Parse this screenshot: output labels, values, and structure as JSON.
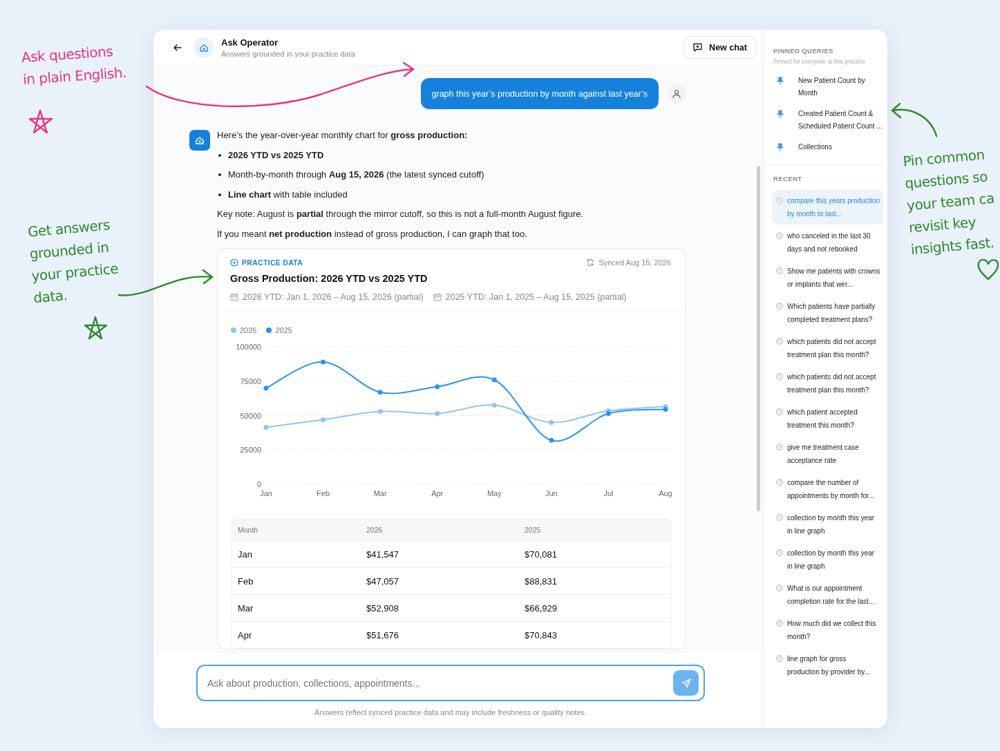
{
  "annotations": [
    {
      "color": "#e8337f",
      "lines": [
        "Ask questions",
        "in plain English."
      ]
    },
    {
      "color": "#2e8a2a",
      "lines": [
        "Get answers",
        "grounded in",
        "your practice",
        "data."
      ]
    },
    {
      "color": "#2e8a2a",
      "lines": [
        "Pin common",
        "questions so",
        "your team ca",
        "revisit key",
        "insights fast."
      ]
    }
  ],
  "header": {
    "title": "Ask Operator",
    "subtitle": "Answers grounded in your practice data",
    "new_chat": "New chat"
  },
  "user_message": "graph this year’s production by month against last year’s",
  "assistant": {
    "intro": "Here’s the year-over-year monthly chart for **gross production:**",
    "bullets": [
      "**2026 YTD vs 2025 YTD**",
      "Month-by-month through **Aug 15, 2026** (the latest synced cutoff)",
      "**Line chart** with table included"
    ],
    "notes": [
      "Key note: August is **partial** through the mirror cutoff, so this is not a full-month August figure.",
      "If you meant **net production** instead of gross production, I can graph that too."
    ]
  },
  "card": {
    "badge": "PRACTICE DATA",
    "synced": "Synced Aug 15, 2026",
    "title": "Gross Production: 2026 YTD vs 2025 YTD",
    "ranges": [
      "2026 YTD: Jan 1, 2026 – Aug 15, 2026 (partial)",
      "2025 YTD: Jan 1, 2025 – Aug 15, 2025 (partial)"
    ],
    "chart_data": {
      "type": "line",
      "categories": [
        "Jan",
        "Feb",
        "Mar",
        "Apr",
        "May",
        "Jun",
        "Jul",
        "Aug"
      ],
      "series": [
        {
          "name": "2026",
          "color": "#8ec5f3",
          "marker": true,
          "values": [
            41500,
            47000,
            53000,
            51500,
            57500,
            45000,
            53500,
            56500
          ]
        },
        {
          "name": "2025",
          "color": "#2b93ea",
          "marker": true,
          "values": [
            70000,
            89000,
            67000,
            71000,
            76000,
            32000,
            51500,
            54500
          ]
        }
      ],
      "grid": true,
      "ylim": [
        0,
        100000
      ],
      "yticks": [
        0,
        25000,
        50000,
        75000,
        100000
      ]
    },
    "table": {
      "columns": [
        "Month",
        "2026",
        "2025"
      ],
      "rows": [
        [
          "Jan",
          "$41,547",
          "$70,081"
        ],
        [
          "Feb",
          "$47,057",
          "$88,831"
        ],
        [
          "Mar",
          "$52,908",
          "$66,929"
        ],
        [
          "Apr",
          "$51,676",
          "$70,843"
        ]
      ]
    }
  },
  "composer": {
    "placeholder": "Ask about production, collections, appointments...",
    "note": "Answers reflect synced practice data and may include freshness or quality notes."
  },
  "sidebar": {
    "pinned": {
      "heading": "PINNED QUERIES",
      "subtitle": "Pinned for everyone at this practice",
      "items": [
        "New Patient Count by Month",
        "Created Patient Count & Scheduled Patient Count ...",
        "Collections"
      ]
    },
    "recent": {
      "heading": "RECENT",
      "items": [
        {
          "text": "compare this years production by month to last...",
          "selected": true
        },
        {
          "text": "who canceled in the last 30 days and not rebooked",
          "selected": false
        },
        {
          "text": "Show me patients with crowns or implants that wer...",
          "selected": false
        },
        {
          "text": "Which patients have partially completed treatment plans?",
          "selected": false
        },
        {
          "text": "which patients did not accept treatment plan this month?",
          "selected": false
        },
        {
          "text": "which patients did not accept treatment plan this month?",
          "selected": false
        },
        {
          "text": "which patient accepted treatment this month?",
          "selected": false
        },
        {
          "text": "give me treatment case acceptance rate",
          "selected": false
        },
        {
          "text": "compare the number of appointments by month for...",
          "selected": false
        },
        {
          "text": "collection by month this year in line graph",
          "selected": false
        },
        {
          "text": "collection by month this year in line graph",
          "selected": false
        },
        {
          "text": "What is our appointment completion rate for the last...",
          "selected": false
        },
        {
          "text": "How much did we collect this month?",
          "selected": false
        },
        {
          "text": "line graph for gross production by provider by...",
          "selected": false
        }
      ]
    }
  }
}
